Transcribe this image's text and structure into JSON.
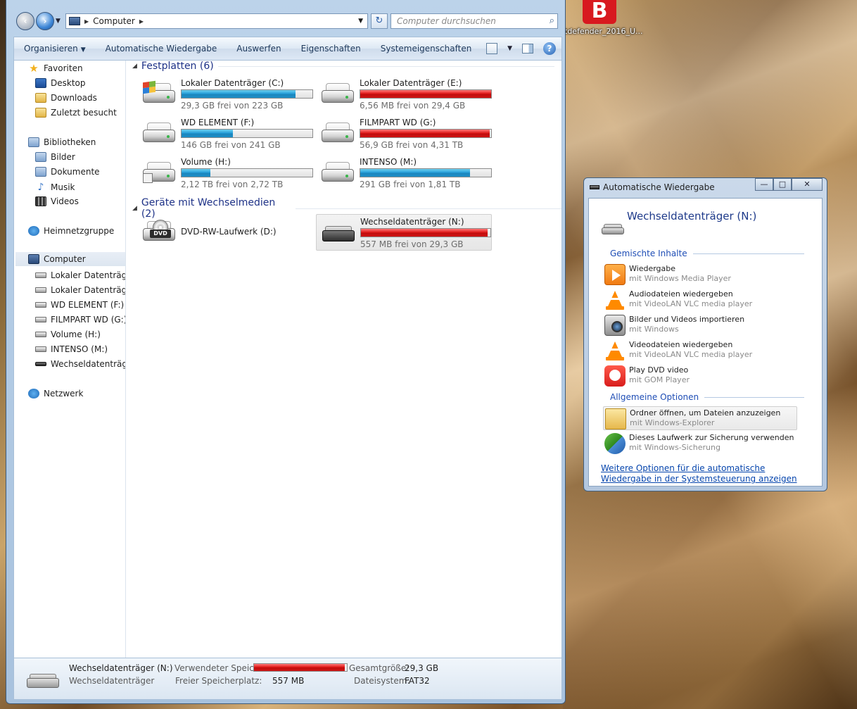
{
  "desktop": {
    "icon_letter": "B",
    "icon_label": "tdefender_2016_U..."
  },
  "explorer": {
    "address": {
      "crumb": "Computer"
    },
    "search": {
      "placeholder": "Computer durchsuchen"
    },
    "commands": [
      "Organisieren",
      "Automatische Wiedergabe",
      "Auswerfen",
      "Eigenschaften",
      "Systemeigenschaften"
    ],
    "more": "»",
    "help": "?",
    "nav": {
      "favorites": "Favoriten",
      "desktop": "Desktop",
      "downloads": "Downloads",
      "recent": "Zuletzt besucht",
      "libraries": "Bibliotheken",
      "pictures": "Bilder",
      "documents": "Dokumente",
      "music": "Musik",
      "videos": "Videos",
      "homegroup": "Heimnetzgruppe",
      "computer": "Computer",
      "drives": [
        "Lokaler Datenträger",
        "Lokaler Datenträger",
        "WD ELEMENT (F:)",
        "FILMPART WD (G:)",
        "Volume (H:)",
        "INTENSO (M:)",
        "Wechseldatenträger"
      ],
      "network": "Netzwerk"
    },
    "groups": {
      "hdd": "Festplatten (6)",
      "removable": "Geräte mit Wechselmedien (2)"
    },
    "hard_drives": [
      {
        "name": "Lokaler Datenträger (C:)",
        "free": "29,3 GB frei von 223 GB",
        "used_fraction": 0.87,
        "color": "#26a0da"
      },
      {
        "name": "Lokaler Datenträger (E:)",
        "free": "6,56 MB frei von 29,4 GB",
        "used_fraction": 1.0,
        "color": "#e01a1a"
      },
      {
        "name": "WD ELEMENT (F:)",
        "free": "146 GB frei von 241 GB",
        "used_fraction": 0.39,
        "color": "#26a0da"
      },
      {
        "name": "FILMPART WD (G:)",
        "free": "56,9 GB frei von 4,31 TB",
        "used_fraction": 0.99,
        "color": "#e01a1a"
      },
      {
        "name": "Volume (H:)",
        "free": "2,12 TB frei von 2,72 TB",
        "used_fraction": 0.22,
        "color": "#26a0da"
      },
      {
        "name": "INTENSO (M:)",
        "free": "291 GB frei von 1,81 TB",
        "used_fraction": 0.84,
        "color": "#26a0da"
      }
    ],
    "removable_drives": [
      {
        "name": "DVD-RW-Laufwerk (D:)",
        "dvd_label": "DVD"
      },
      {
        "name": "Wechseldatenträger (N:)",
        "free": "557 MB frei von 29,3 GB",
        "used_fraction": 0.98,
        "color": "#e01a1a"
      }
    ],
    "details": {
      "title": "Wechseldatenträger (N:)",
      "subtitle": "Wechseldatenträger",
      "used_label": "Verwendeter Speic...",
      "used_fraction": 0.98,
      "free_label": "Freier Speicherplatz:",
      "free_value": "557 MB",
      "total_label": "Gesamtgröße:",
      "total_value": "29,3 GB",
      "fs_label": "Dateisystem:",
      "fs_value": "FAT32"
    }
  },
  "autoplay": {
    "title": "Automatische Wiedergabe",
    "minimize": "—",
    "maximize": "□",
    "close": "✕",
    "heading": "Wechseldatenträger (N:)",
    "section_mixed": "Gemischte Inhalte",
    "section_general": "Allgemeine Optionen",
    "options": [
      {
        "main": "Wiedergabe",
        "sub": "mit Windows Media Player",
        "icon": "wmp-icon"
      },
      {
        "main": "Audiodateien wiedergeben",
        "sub": "mit VideoLAN VLC media player",
        "icon": "vlc-icon"
      },
      {
        "main": "Bilder und Videos importieren",
        "sub": "mit Windows",
        "icon": "camera-icon"
      },
      {
        "main": "Videodateien wiedergeben",
        "sub": "mit VideoLAN VLC media player",
        "icon": "vlc-icon"
      },
      {
        "main": "Play DVD video",
        "sub": "mit GOM Player",
        "icon": "gom-icon"
      }
    ],
    "general_options": [
      {
        "main": "Ordner öffnen, um Dateien anzuzeigen",
        "sub": "mit Windows-Explorer",
        "icon": "folder-icon"
      },
      {
        "main": "Dieses Laufwerk zur Sicherung verwenden",
        "sub": "mit Windows-Sicherung",
        "icon": "backup-icon"
      }
    ],
    "link": "Weitere Optionen für die automatische Wiedergabe in der Systemsteuerung anzeigen"
  }
}
